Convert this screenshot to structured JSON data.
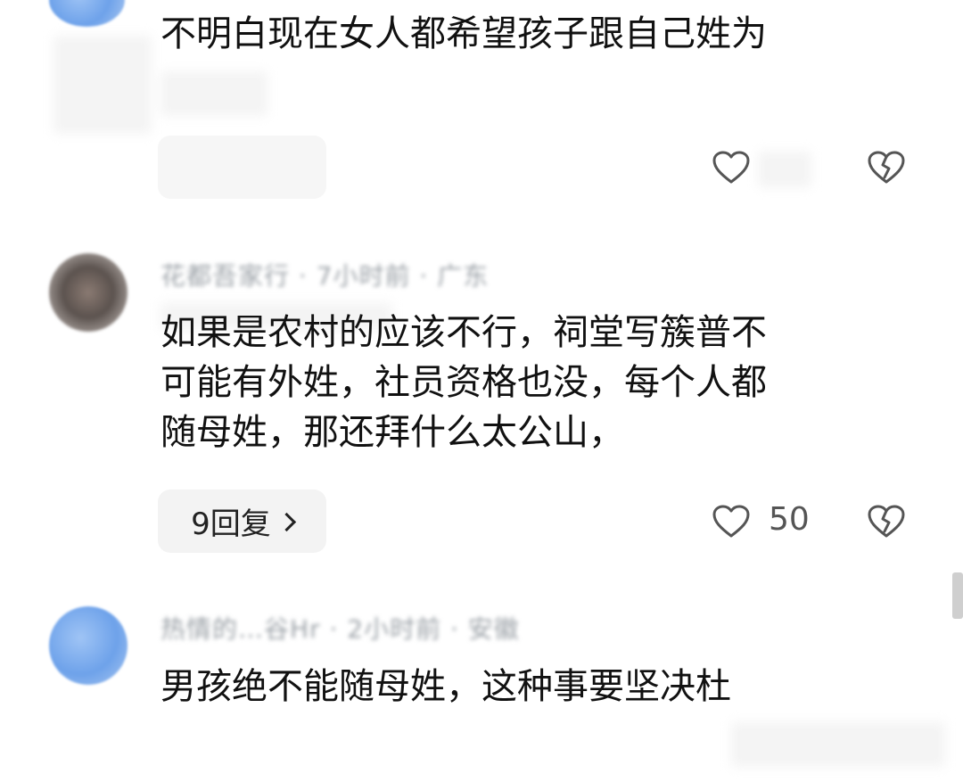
{
  "comments": [
    {
      "text_lines": [
        "不明白现在女人都希望孩子跟自己姓为"
      ],
      "reply_label": "",
      "like_count": ""
    },
    {
      "meta": "花都吾家行 · 7小时前 · 广东",
      "text_lines": [
        "如果是农村的应该不行，祠堂写簇普不",
        "可能有外姓，社员资格也没，每个人都",
        "随母姓，那还拜什么太公山，"
      ],
      "reply_label": "9回复",
      "like_count": "50"
    },
    {
      "meta": "热情的…谷Hr · 2小时前 · 安徽",
      "text_lines": [
        "男孩绝不能随母姓，这种事要坚决杜"
      ]
    }
  ],
  "icons": {
    "like": "heart-outline-icon",
    "dislike": "broken-heart-icon",
    "reply_arrow": "chevron-right-icon"
  },
  "colors": {
    "text": "#111111",
    "meta": "#9aa0a6",
    "pill_bg": "#f3f3f3",
    "icon": "#555555"
  }
}
